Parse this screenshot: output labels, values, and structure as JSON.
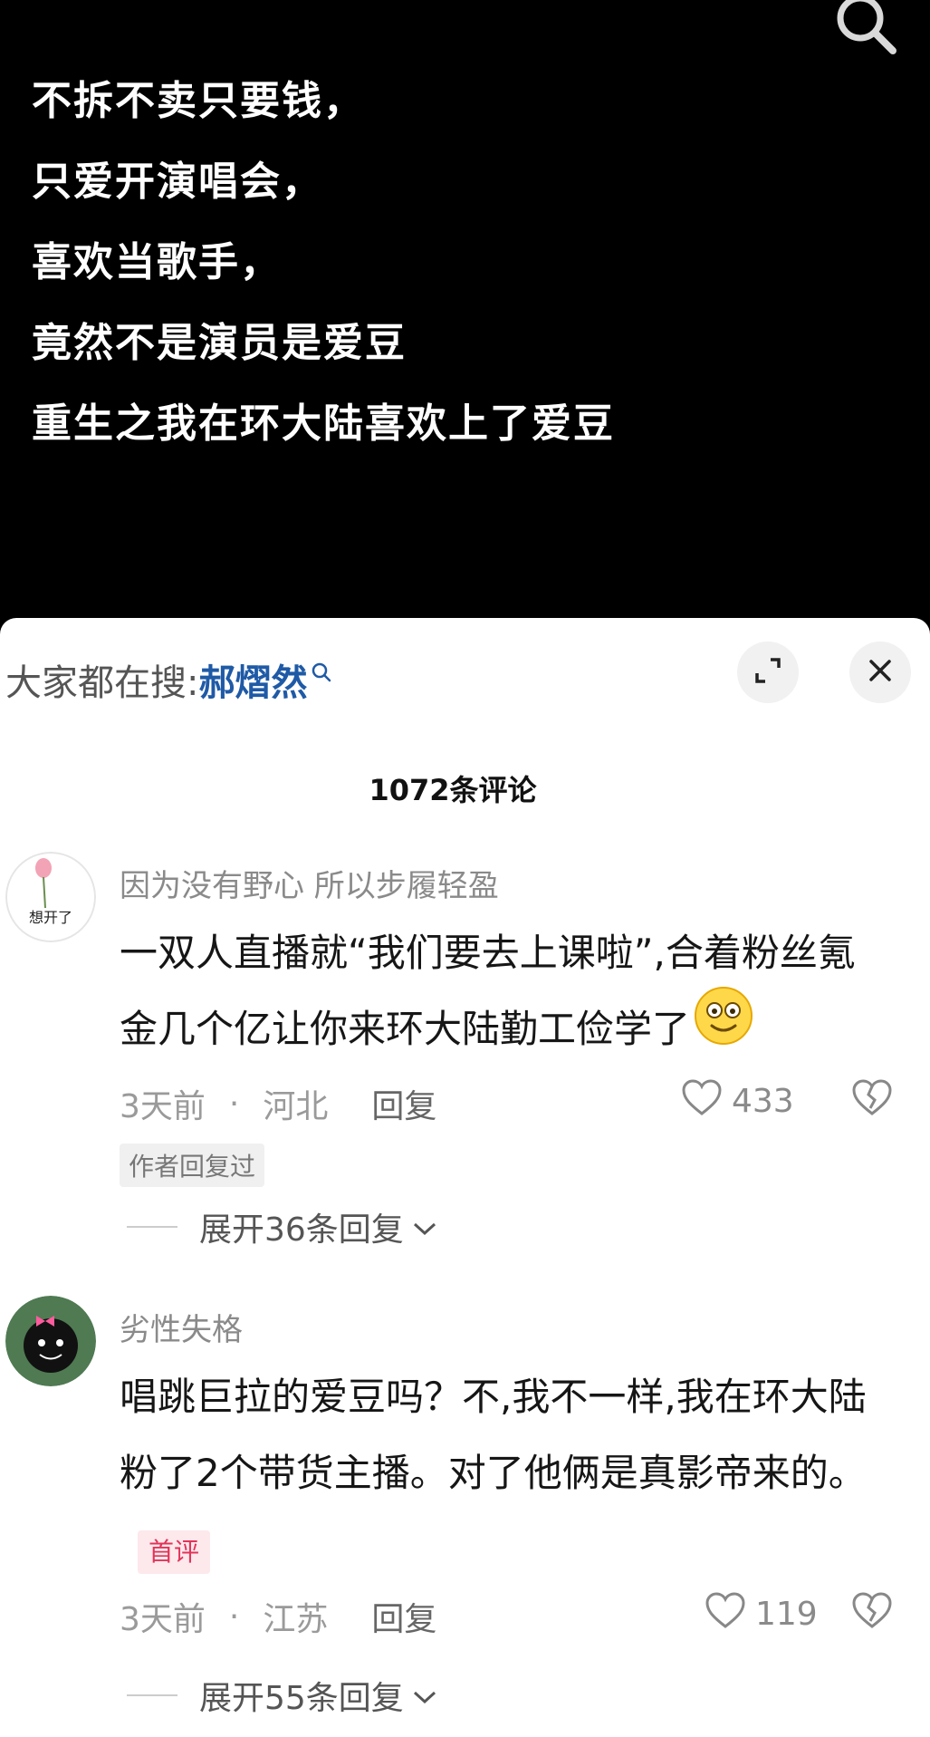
{
  "video": {
    "lines": [
      "不拆不卖只要钱，",
      "只爱开演唱会，",
      "喜欢当歌手，",
      "竟然不是演员是爱豆",
      "重生之我在环大陆喜欢上了爱豆"
    ]
  },
  "panel": {
    "hot_search_prefix": "大家都在搜:",
    "hot_search_term": "郝熠然",
    "comment_count": "1072条评论"
  },
  "comments": [
    {
      "username": "因为没有野心 所以步履轻盈",
      "avatar_text": "想开了",
      "text": "一双人直播就“我们要去上课啦”,合着粉丝氪金几个亿让你来环大陆勤工俭学了",
      "time": "3天前",
      "location": "河北",
      "reply_label": "回复",
      "likes": "433",
      "author_replied": "作者回复过",
      "expand_label": "展开36条回复"
    },
    {
      "username": "劣性失格",
      "text": "唱跳巨拉的爱豆吗？不,我不一样,我在环大陆粉了2个带货主播。对了他俩是真影帝来的。",
      "first_badge": "首评",
      "time": "3天前",
      "location": "江苏",
      "reply_label": "回复",
      "likes": "119",
      "expand_label": "展开55条回复"
    }
  ],
  "colors": {
    "link_blue": "#1f5aa6",
    "badge_red": "#e1345a",
    "muted_gray": "#9a9a9a"
  },
  "icons": [
    "search-icon",
    "expand-icon",
    "close-icon",
    "heart-icon",
    "broken-heart-icon",
    "chevron-down-icon",
    "smile-emoji-icon"
  ]
}
